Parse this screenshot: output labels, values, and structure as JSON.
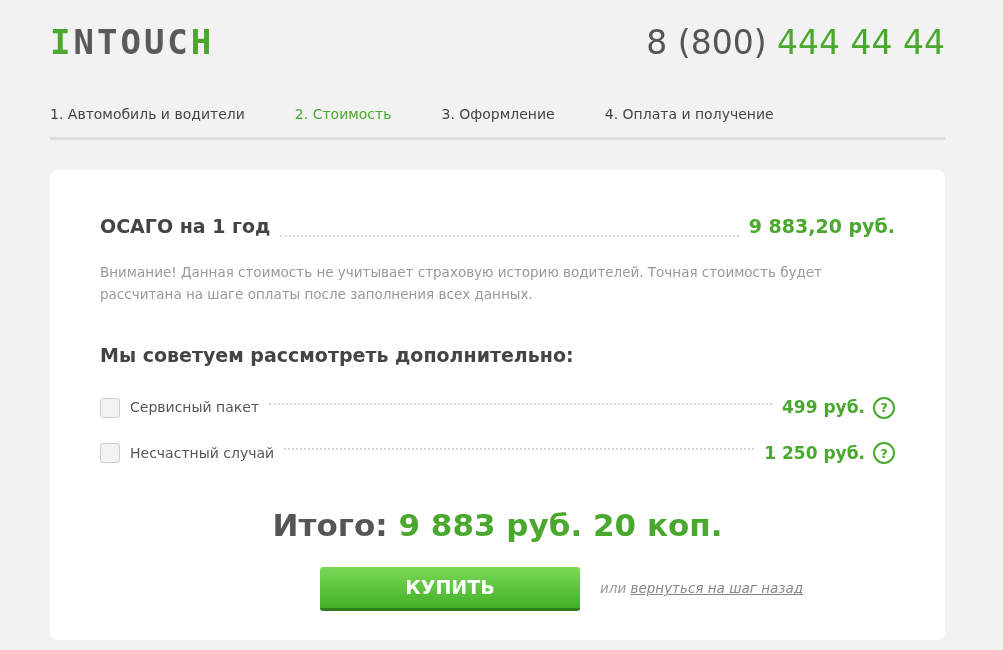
{
  "logo": {
    "first": "I",
    "middle": "NTOUC",
    "last": "H"
  },
  "phone": {
    "prefix": "8 (800)",
    "number": "444 44 44"
  },
  "steps": [
    {
      "label": "1. Автомобиль и водители",
      "selected": false
    },
    {
      "label": "2. Стоимость",
      "selected": true
    },
    {
      "label": "3. Оформление",
      "selected": false
    },
    {
      "label": "4. Оплата и получение",
      "selected": false
    }
  ],
  "policy": {
    "title": "ОСАГО на 1 год",
    "price": "9 883,20 руб."
  },
  "notice": "Внимание! Данная стоимость не учитывает страховую историю водителей. Точная стоимость будет рассчитана на шаге оплаты после заполнения всех данных.",
  "extras_heading": "Мы советуем рассмотреть дополнительно:",
  "extras": [
    {
      "label": "Сервисный пакет",
      "price": "499 руб.",
      "checked": false,
      "help": "?"
    },
    {
      "label": "Несчастный случай",
      "price": "1 250 руб.",
      "checked": false,
      "help": "?"
    }
  ],
  "total": {
    "label": "Итого:",
    "amount": "9 883 руб. 20 коп."
  },
  "buy_button": "КУПИТЬ",
  "back": {
    "prefix": "или",
    "link": "вернуться на шаг назад"
  }
}
